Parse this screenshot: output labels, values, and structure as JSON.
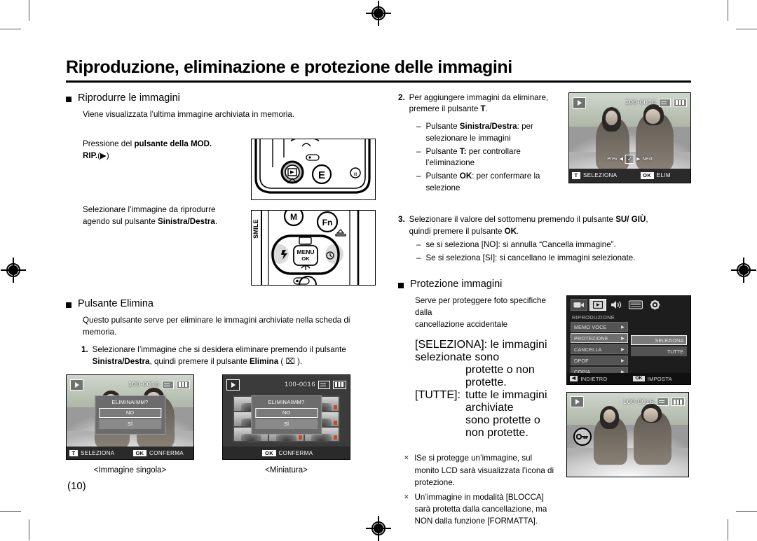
{
  "document": {
    "title": "Riproduzione, eliminazione e protezione delle immagini",
    "page_number": "(10)"
  },
  "left_column": {
    "section1": {
      "heading": "Riprodurre le immagini",
      "intro": "Viene visualizzata l’ultima immagine archiviata in memoria.",
      "step_press_line1_plain": "Pressione del ",
      "step_press_line1_bold": "pulsante della MOD.",
      "step_press_line2_bold": "RIP.",
      "step_press_line2_icon": "(▶)",
      "select_line1": "Selezionare l’immagine da riprodurre",
      "select_line2_plain": "agendo sul pulsante ",
      "select_line2_bold": "Sinistra/Destra",
      "select_line2_end": "."
    },
    "section2": {
      "heading": "Pulsante Elimina",
      "intro_line1": "Questo pulsante serve per eliminare le immagini archiviate nella scheda di",
      "intro_line2": "memoria.",
      "step1_num": "1.",
      "step1_line1": "Selezionare l’immagine che si desidera eliminare premendo il pulsante",
      "step1_line2_bold1": "Sinistra/Destra",
      "step1_line2_mid": ", quindi premere il pulsante ",
      "step1_line2_bold2": "Elimina",
      "step1_line2_end": " ( ⌧ )."
    },
    "captions": {
      "single": "<Immagine singola>",
      "thumbnail": "<Miniatura>"
    },
    "lcd_single": {
      "file_number": "100-0016",
      "dialog_title": "ELIMINAIMM?",
      "option_no": "NO",
      "option_yes": "SÌ",
      "bottom_key_t": "T",
      "bottom_label_t": "SELEZIONA",
      "bottom_key_ok": "OK",
      "bottom_label_ok": "CONFERMA"
    },
    "lcd_thumb": {
      "file_number": "100-0016",
      "dialog_title": "ELIMINAIMM?",
      "option_no": "NO",
      "option_yes": "SÌ",
      "bottom_key_ok": "OK",
      "bottom_label_ok": "CONFERMA"
    }
  },
  "right_column": {
    "step2": {
      "num": "2.",
      "line1": "Per aggiungere immagini da eliminare,",
      "line2_plain": "premere il pulsante ",
      "line2_bold": "T",
      "line2_end": ".",
      "sub": [
        {
          "plain1": "Pulsante ",
          "bold": "Sinistra/Destra",
          "plain2": ": per",
          "line2": "selezionare le immagini"
        },
        {
          "plain1": "Pulsante ",
          "bold": "T:",
          "plain2": " per controllare",
          "line2": "l’eliminazione"
        },
        {
          "plain1": "Pulsante ",
          "bold": "OK",
          "plain2": ": per confermare la",
          "line2": "selezione"
        }
      ]
    },
    "step3": {
      "num": "3.",
      "line1_plain": "Selezionare il valore del sottomenu premendo il pulsante ",
      "line1_bold": "SU/ GIÙ",
      "line1_end": ",",
      "line2_plain": "quindi premere il pulsante ",
      "line2_bold": "OK",
      "line2_end": ".",
      "sub": [
        "se si seleziona [NO]: si annulla “Cancella immagine”.",
        "Se si seleziona [SI]: si cancellano le immagini selezionate."
      ]
    },
    "section_protect": {
      "heading": "Protezione immagini",
      "intro_line1": "Serve per proteggere foto specifiche dalla",
      "intro_line2": "cancellazione accidentale",
      "opt1_key": "[SELEZIONA]:",
      "opt1_line1": "le immagini selezionate sono",
      "opt1_line2": "protette o non protette.",
      "opt2_key": "[TUTTE]:",
      "opt2_line1": "tutte le immagini archiviate",
      "opt2_line2": "sono protette o non protette.",
      "notes": [
        {
          "l1": "lSe si protegge un’immagine, sul",
          "l2": "monito LCD sarà visualizzata l’icona di",
          "l3": "protezione."
        },
        {
          "l1": "Un’immagine in modalità [BLOCCA]",
          "l2": "sarà protetta dalla cancellazione, ma",
          "l3": "NON dalla funzione [FORMATTA]."
        }
      ]
    },
    "lcd_select": {
      "file_number": "100-0016",
      "prev_label": "Prev",
      "next_label": "Next",
      "check_glyph": "✓",
      "bottom_key_t": "T",
      "bottom_label_t": "SELEZIONA",
      "bottom_key_ok": "OK",
      "bottom_label_ok": "ELIM"
    },
    "lcd_menu": {
      "tabs": [
        {
          "name": "camera-tab",
          "glyph": "▶●",
          "active": false
        },
        {
          "name": "playback-tab",
          "glyph": "▶",
          "active": true
        },
        {
          "name": "sound-tab",
          "glyph": "◀)",
          "active": false
        },
        {
          "name": "display-tab",
          "glyph": "▤",
          "active": false
        },
        {
          "name": "setup-tab",
          "glyph": "⚙",
          "active": false
        }
      ],
      "header": "RIPRODUZIONE",
      "items": [
        {
          "label": "MEMO VOCE",
          "selected": false
        },
        {
          "label": "PROTEZIONE",
          "selected": true
        },
        {
          "label": "CANCELLA",
          "selected": false
        },
        {
          "label": "DPOF",
          "selected": false
        },
        {
          "label": "COPIA",
          "selected": false
        }
      ],
      "submenu": [
        {
          "label": "SELEZIONA",
          "selected": true
        },
        {
          "label": "TUTTE",
          "selected": false
        }
      ],
      "bottom_key_back": "◀",
      "bottom_label_back": "INDIETRO",
      "bottom_key_ok": "OK",
      "bottom_label_ok": "IMPOSTA"
    },
    "lcd_protected": {
      "file_number": "100-0016",
      "protect_icon": "⚷"
    }
  }
}
